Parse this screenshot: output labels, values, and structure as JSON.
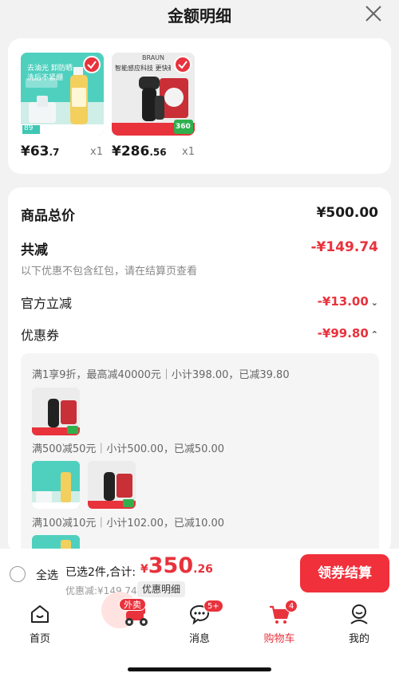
{
  "header": {
    "title": "金额明细"
  },
  "products": [
    {
      "price_int": "¥63",
      "price_dec": ".7",
      "qty": "x1",
      "banner": "去油光 卸防晒 洗后不紧绷",
      "tag": "89",
      "image": "cleansing-oil-product-image"
    },
    {
      "price_int": "¥286",
      "price_dec": ".56",
      "qty": "x1",
      "brand": "BRAUN",
      "banner": "智能感应科技 更快剃净",
      "tag": "360",
      "image": "electric-shaver-product-image"
    }
  ],
  "summary": {
    "total_label": "商品总价",
    "total_value": "¥500.00",
    "reduction_label": "共减",
    "reduction_value": "-¥149.74",
    "reduction_note": "以下优惠不包含红包，请在结算页查看",
    "official_label": "官方立减",
    "official_value": "-¥13.00",
    "coupon_label": "优惠券",
    "coupon_value": "-¥99.80"
  },
  "coupons": [
    {
      "rule": "满1享9折，最高减40000元｜小计398.00，已减39.80"
    },
    {
      "rule": "满500减50元｜小计500.00，已减50.00"
    },
    {
      "rule": "满100减10元｜小计102.00，已减10.00"
    }
  ],
  "bottom_bar": {
    "select_all": "全选",
    "selected_text": "已选2件,合计:",
    "total_yen": "¥",
    "total_big": "350",
    "total_dec": ".26",
    "discount_text": "优惠减:¥149.74",
    "detail_button": "优惠明细",
    "checkout_button": "领券结算"
  },
  "tabbar": {
    "items": [
      {
        "label": "首页",
        "icon": "home-icon"
      },
      {
        "label": "外卖",
        "icon": "delivery-scooter-icon"
      },
      {
        "label": "消息",
        "icon": "message-icon",
        "badge": "5+"
      },
      {
        "label": "购物车",
        "icon": "cart-icon",
        "badge": "4",
        "active": true
      },
      {
        "label": "我的",
        "icon": "profile-icon"
      }
    ]
  },
  "colors": {
    "accent": "#e8323c",
    "checkout": "#f0303b"
  }
}
